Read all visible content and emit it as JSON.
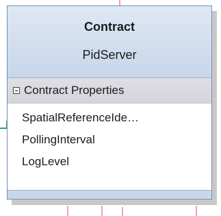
{
  "shape": {
    "stereotype": "Contract",
    "name": "PidServer",
    "compartment": {
      "title": "Contract Properties",
      "collapse_icon": "minus-box-icon",
      "properties": [
        "SpatialReferenceIde…",
        "PollingInterval",
        "LogLevel"
      ]
    }
  },
  "colors": {
    "header_top": "#dfe8f4",
    "header_bottom": "#c7d6ea",
    "border": "#6f8fb5",
    "connector_pink": "#f0a0b8",
    "connector_green": "#3d9a6e"
  }
}
